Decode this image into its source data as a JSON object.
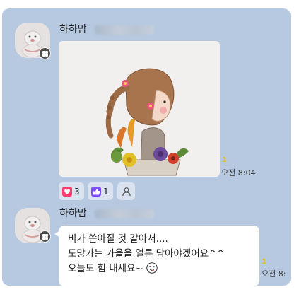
{
  "messages": [
    {
      "sender": "하하맘",
      "unread_count": "1",
      "time": "오전 8:04",
      "photo_alt": "drawing of a girl holding a flower basket",
      "reactions": [
        {
          "icon": "heart-icon",
          "count": "3"
        },
        {
          "icon": "thumbs-up-icon",
          "count": "1"
        },
        {
          "icon": "person-icon",
          "count": ""
        }
      ]
    },
    {
      "sender": "하하맘",
      "unread_count": "1",
      "time": "오전 8:",
      "text_lines": [
        "비가 쏟아질 것 같아서....",
        "도망가는 가을을 얼른 담아야겠어요^^",
        "오늘도 힘 내세요~"
      ],
      "trailing_emoji": "winking-face-emoji"
    }
  ],
  "colors": {
    "chat_background": "#b6c9e0",
    "bubble": "#ffffff",
    "heart_reaction": "#ff3d6e",
    "like_reaction": "#7c4dff",
    "unread": "#e2c300"
  }
}
